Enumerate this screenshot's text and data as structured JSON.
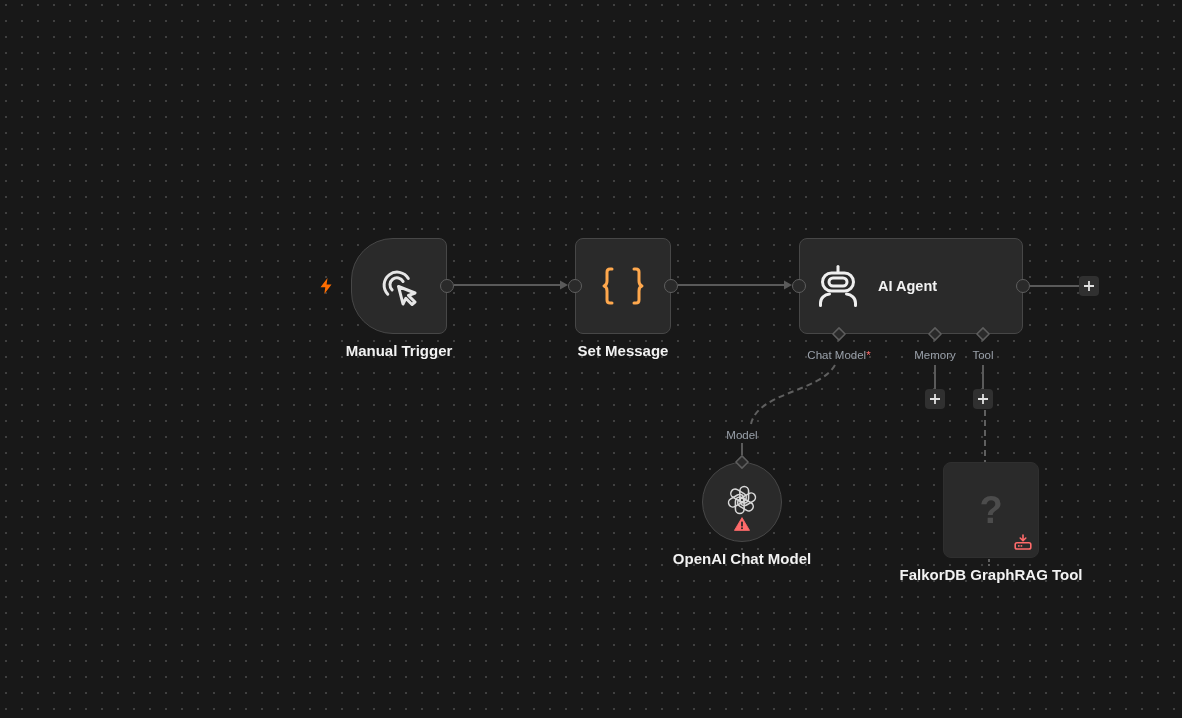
{
  "canvas": {
    "nodes": [
      {
        "kind": "trigger",
        "label": "Manual Trigger"
      },
      {
        "kind": "set",
        "label": "Set Message"
      },
      {
        "kind": "agent",
        "label": "AI Agent",
        "output_add_button": true,
        "inputs": [
          {
            "label": "Chat Model",
            "required_mark": "*",
            "add_button": false
          },
          {
            "label": "Memory",
            "add_button": true
          },
          {
            "label": "Tool",
            "add_button": true
          }
        ]
      },
      {
        "kind": "chat_model",
        "label": "OpenAI Chat Model",
        "output_label": "Model",
        "warning": true
      },
      {
        "kind": "unknown_tool",
        "glyph": "?",
        "label": "FalkorDB GraphRAG Tool",
        "install_needed": true
      }
    ]
  }
}
